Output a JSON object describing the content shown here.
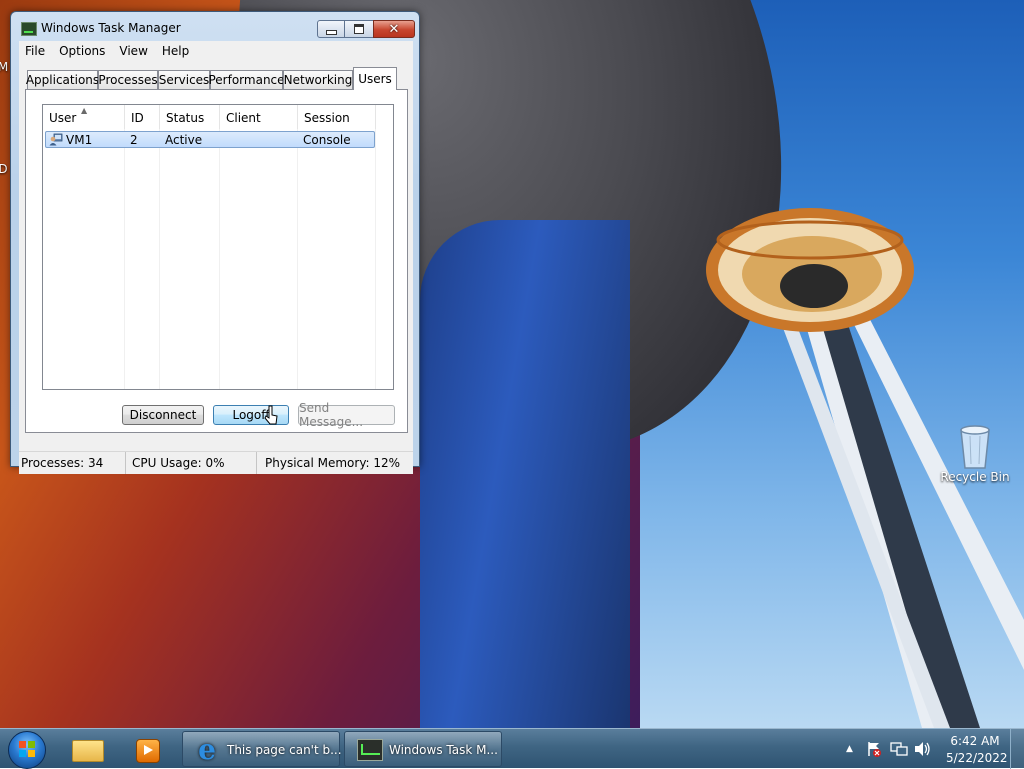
{
  "desktop": {
    "recycle_bin_label": "Recycle Bin",
    "left_edge_labels": [
      "M",
      "D"
    ]
  },
  "window": {
    "title": "Windows Task Manager",
    "close_glyph": "✕",
    "menu": [
      "File",
      "Options",
      "View",
      "Help"
    ],
    "tabs": [
      "Applications",
      "Processes",
      "Services",
      "Performance",
      "Networking",
      "Users"
    ],
    "active_tab": "Users",
    "columns": [
      "User",
      "ID",
      "Status",
      "Client Name",
      "Session"
    ],
    "sorted_column": "User",
    "rows": [
      {
        "user": "VM1",
        "id": "2",
        "status": "Active",
        "client_name": "",
        "session": "Console",
        "icon": "user-icon"
      }
    ],
    "buttons": {
      "disconnect": "Disconnect",
      "logoff": "Logoff",
      "send_message": "Send Message..."
    },
    "status_bar": {
      "processes": "Processes: 34",
      "cpu": "CPU Usage: 0%",
      "memory": "Physical Memory: 12%"
    }
  },
  "taskbar": {
    "tasks": [
      {
        "label": "This page can't b...",
        "icon": "internet-explorer-icon"
      },
      {
        "label": "Windows Task M...",
        "icon": "task-manager-icon"
      }
    ],
    "clock": {
      "time": "6:42 AM",
      "date": "5/22/2022"
    }
  },
  "colors": {
    "selection_fill": "#c1dbfc",
    "selection_border": "#7da2ce",
    "close_button": "#c7462f",
    "taskbar": "#3f6583"
  }
}
